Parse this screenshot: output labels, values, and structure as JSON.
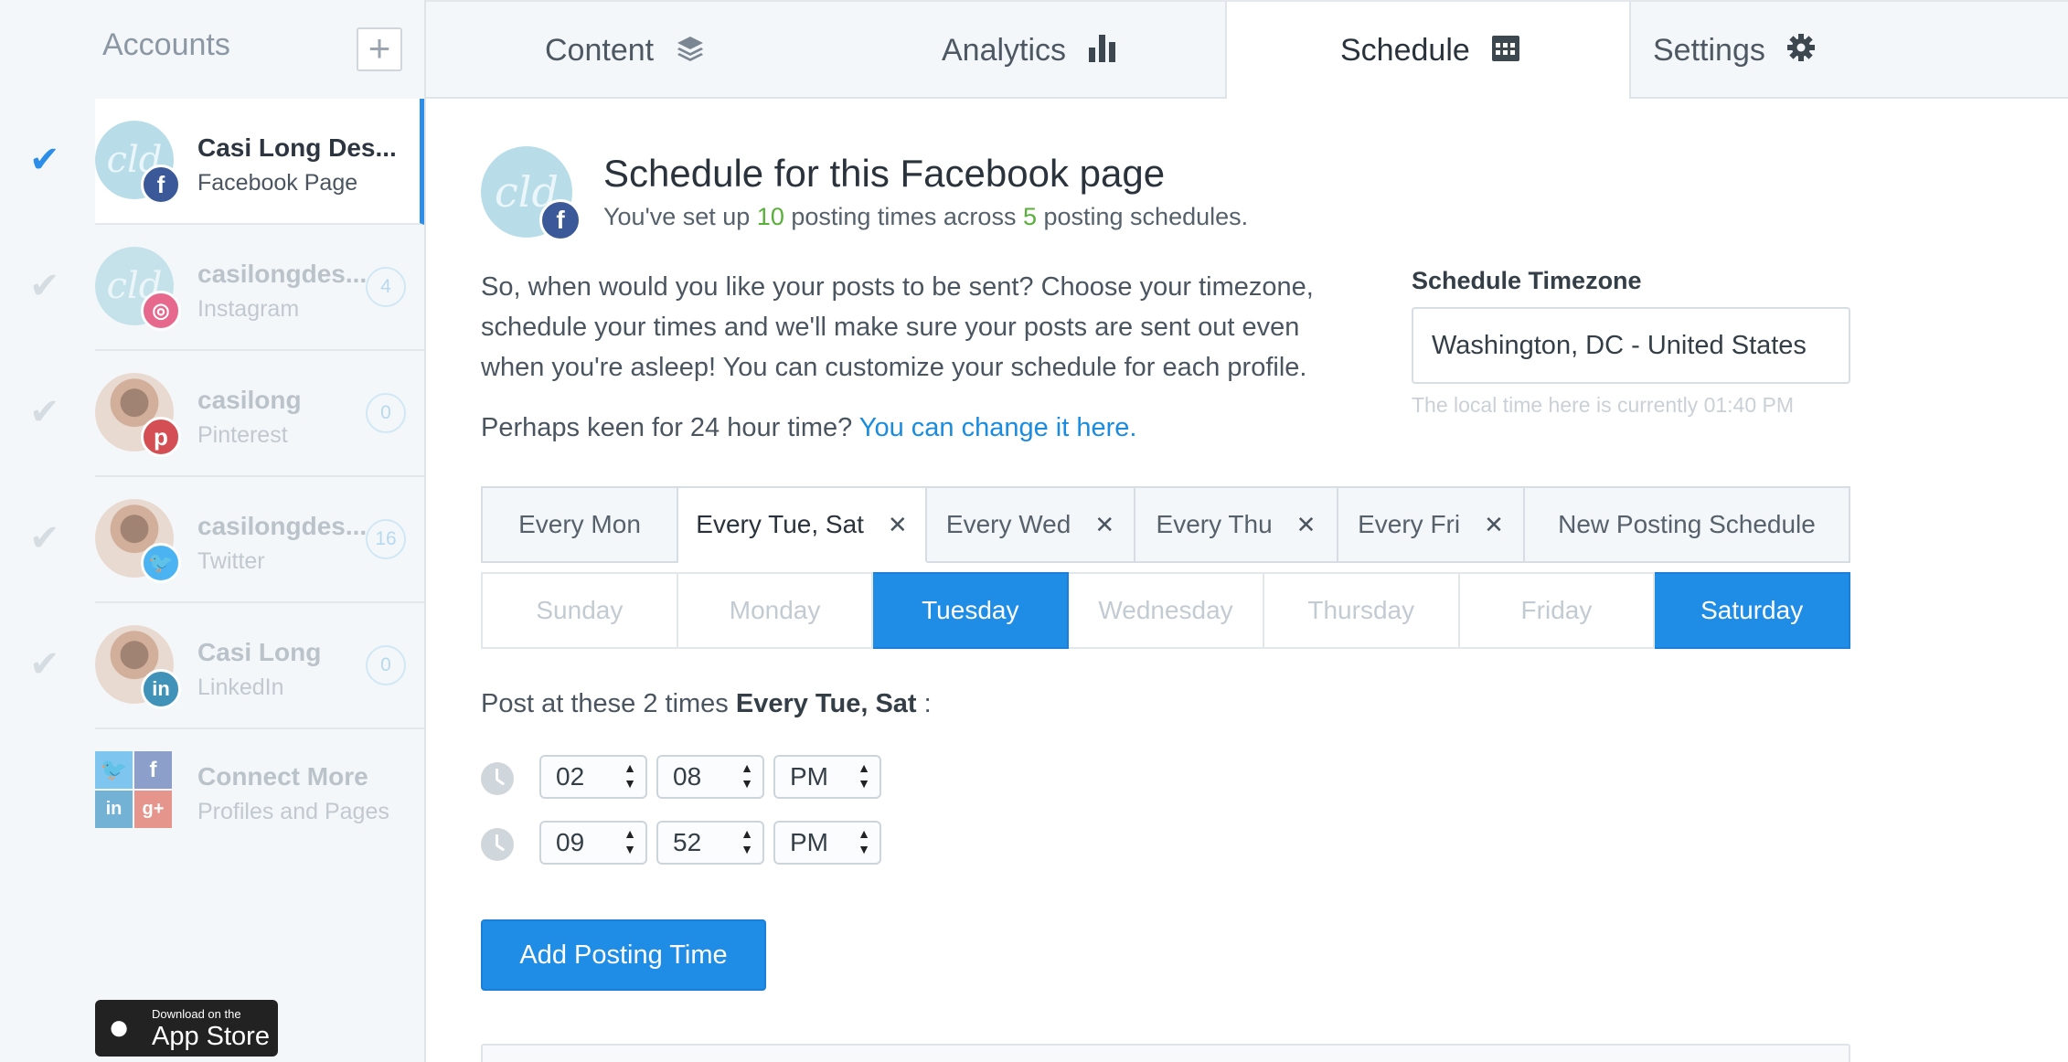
{
  "sidebar": {
    "header": "Accounts",
    "add_icon": "plus-icon",
    "accounts": [
      {
        "name": "Casi Long Des...",
        "type": "Facebook Page",
        "network": "facebook",
        "initials": "cld",
        "count": "",
        "active": true
      },
      {
        "name": "casilongdes...",
        "type": "Instagram",
        "network": "instagram",
        "initials": "cld",
        "count": "4",
        "active": false
      },
      {
        "name": "casilong",
        "type": "Pinterest",
        "network": "pinterest",
        "initials": "",
        "count": "0",
        "active": false
      },
      {
        "name": "casilongdes...",
        "type": "Twitter",
        "network": "twitter",
        "initials": "",
        "count": "16",
        "active": false
      },
      {
        "name": "Casi Long",
        "type": "LinkedIn",
        "network": "linkedin",
        "initials": "",
        "count": "0",
        "active": false
      }
    ],
    "connect": {
      "title": "Connect More",
      "subtitle": "Profiles and Pages"
    },
    "app_store": {
      "small": "Download on the",
      "big": "App Store"
    }
  },
  "tabs": [
    {
      "label": "Content",
      "icon": "layers-icon"
    },
    {
      "label": "Analytics",
      "icon": "bar-chart-icon"
    },
    {
      "label": "Schedule",
      "icon": "calendar-icon"
    },
    {
      "label": "Settings",
      "icon": "gear-icon"
    }
  ],
  "page": {
    "initials": "cld",
    "title": "Schedule for this Facebook page",
    "sub_pre": "You've set up ",
    "posting_times": "10",
    "sub_mid": " posting times across ",
    "schedules": "5",
    "sub_post": " posting schedules.",
    "intro": "So, when would you like your posts to be sent? Choose your timezone, schedule your times and we'll make sure your posts are sent out even when you're asleep! You can customize your schedule for each profile.",
    "keen_text": "Perhaps keen for 24 hour time? ",
    "keen_link": "You can change it here."
  },
  "timezone": {
    "label": "Schedule Timezone",
    "value": "Washington, DC - United States",
    "note": "The local time here is currently 01:40 PM"
  },
  "schedule_tabs": [
    {
      "label": "Every Mon",
      "closable": false
    },
    {
      "label": "Every Tue, Sat",
      "closable": true
    },
    {
      "label": "Every Wed",
      "closable": true
    },
    {
      "label": "Every Thu",
      "closable": true
    },
    {
      "label": "Every Fri",
      "closable": true
    },
    {
      "label": "New Posting Schedule",
      "closable": false
    }
  ],
  "days": [
    {
      "label": "Sunday",
      "selected": false
    },
    {
      "label": "Monday",
      "selected": false
    },
    {
      "label": "Tuesday",
      "selected": true
    },
    {
      "label": "Wednesday",
      "selected": false
    },
    {
      "label": "Thursday",
      "selected": false
    },
    {
      "label": "Friday",
      "selected": false
    },
    {
      "label": "Saturday",
      "selected": true
    }
  ],
  "post_at": {
    "pre": "Post at these 2 times ",
    "schedule": "Every Tue, Sat",
    "post": " :"
  },
  "times": [
    {
      "hour": "02",
      "minute": "08",
      "ampm": "PM"
    },
    {
      "hour": "09",
      "minute": "52",
      "ampm": "PM"
    }
  ],
  "add_button": "Add Posting Time",
  "colors": {
    "accent": "#1f8ce6",
    "facebook": "#3b5998",
    "instagram": "#e4406f",
    "pinterest": "#cb2027",
    "twitter": "#1da1f2",
    "linkedin": "#0e76a8",
    "green": "#5aaf3b"
  }
}
